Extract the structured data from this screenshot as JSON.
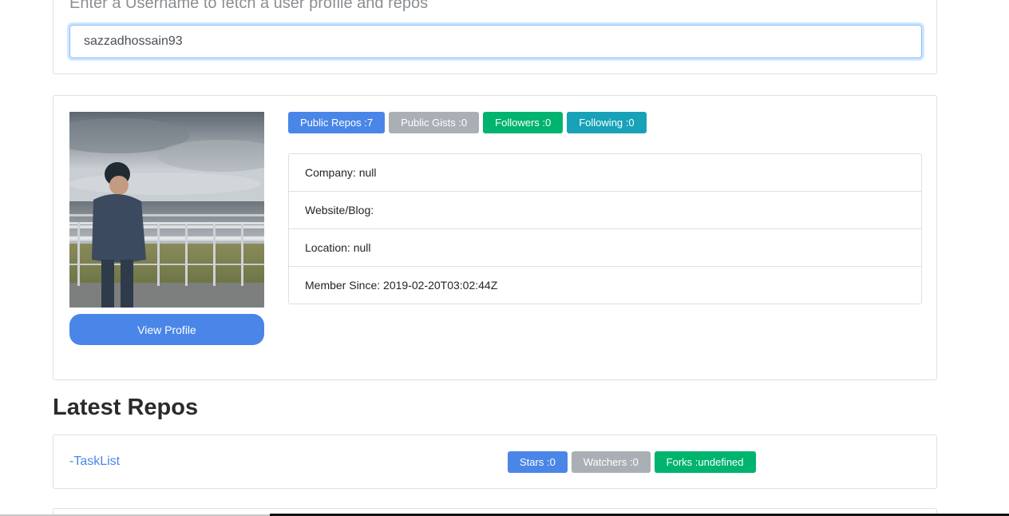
{
  "search": {
    "hint": "Enter a Username to fetch a user profile and repos",
    "value": "sazzadhossain93"
  },
  "profile": {
    "view_profile_label": "View Profile",
    "badges": [
      {
        "label": "Public Repos :7",
        "color": "#4a86e8"
      },
      {
        "label": "Public Gists :0",
        "color": "#a9afb5"
      },
      {
        "label": "Followers :0",
        "color": "#00b36e"
      },
      {
        "label": "Following :0",
        "color": "#17a2b8"
      }
    ],
    "info": [
      "Company: null",
      "Website/Blog:",
      "Location: null",
      "Member Since: 2019-02-20T03:02:44Z"
    ]
  },
  "repos": {
    "title": "Latest Repos",
    "items": [
      {
        "name": "-TaskList",
        "badges": [
          {
            "label": "Stars :0",
            "color": "#4a86e8"
          },
          {
            "label": "Watchers :0",
            "color": "#a9afb5"
          },
          {
            "label": "Forks :undefined",
            "color": "#00b36e"
          }
        ]
      }
    ]
  },
  "colors": {
    "primary": "#4a86e8",
    "secondary": "#a9afb5",
    "success": "#00b36e",
    "info": "#17a2b8"
  }
}
